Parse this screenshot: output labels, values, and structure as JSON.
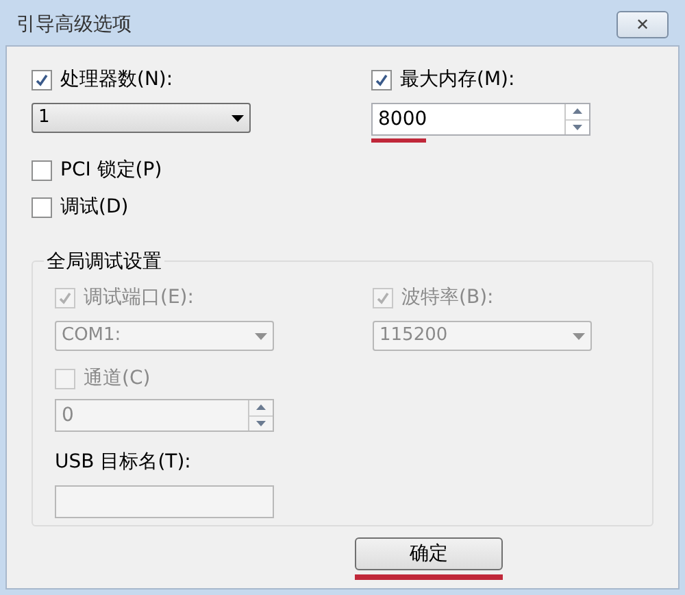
{
  "window": {
    "title": "引导高级选项",
    "close": "✕"
  },
  "processors": {
    "label": "处理器数(N):",
    "checked": true,
    "value": "1",
    "disabled": false
  },
  "max_memory": {
    "label": "最大内存(M):",
    "checked": true,
    "value": "8000",
    "disabled": false,
    "underlined": true
  },
  "options": [
    {
      "label": "PCI 锁定(P)",
      "checked": false
    },
    {
      "label": "调试(D)",
      "checked": false
    }
  ],
  "group": {
    "title": "全局调试设置",
    "debug_port": {
      "label": "调试端口(E):",
      "checked": true,
      "value": "COM1:",
      "disabled": true
    },
    "baud_rate": {
      "label": "波特率(B):",
      "checked": true,
      "value": "115200",
      "disabled": true
    },
    "channel": {
      "label": "通道(C)",
      "checked": false,
      "value": "0",
      "disabled": true
    },
    "usb_target": {
      "label": "USB 目标名(T):",
      "disabled": true
    }
  },
  "buttons": [
    {
      "label": "确定",
      "underlined": true
    }
  ]
}
